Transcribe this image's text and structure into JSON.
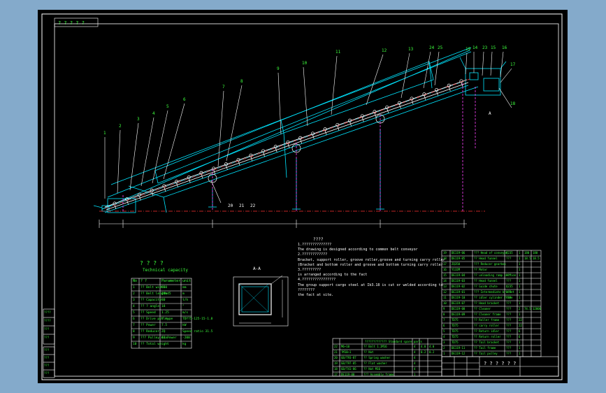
{
  "drawing": {
    "title_question_marks": "? ? ? ?",
    "title_subtitle": "Technical capacity",
    "corner_tag": "? ? ? ? ?",
    "section_label": "A-A",
    "view_arrow_label": "A",
    "balloons_top": [
      "1",
      "2",
      "3",
      "4",
      "5",
      "6",
      "7",
      "8",
      "9",
      "10",
      "11",
      "12",
      "13",
      "24",
      "25",
      "19",
      "14",
      "23",
      "15",
      "16",
      "17",
      "18"
    ],
    "balloons_bottom": [
      "20",
      "21",
      "22"
    ],
    "balloon_22_alt": "22"
  },
  "notes": {
    "heading": "????",
    "lines": [
      "1.??????????????",
      "  The drawing is designed according to common belt conveyor",
      "2.????????????",
      "  Bracket, support roller, groove roller,groove and turning carry roller",
      "  (Bracket and bottom roller and groove and bottom turning carry roller",
      "3.?????????",
      "  is arranged according to the fact",
      "4.????????????????",
      "  The group support cargo steel at Ib3.18 is cut or welded according to",
      "  ????????",
      "  the fact at site."
    ]
  },
  "tech_table": {
    "headers": [
      "No",
      "? ?",
      "Parameter",
      "unit"
    ],
    "rows": [
      [
        "1",
        "?? Belt width",
        "650",
        "mm"
      ],
      [
        "2",
        "?? Belt length",
        "10m45",
        "m"
      ],
      [
        "3",
        "?? Capacity",
        "80",
        "t/h"
      ],
      [
        "4",
        "?? ? angle",
        "18",
        "°"
      ],
      [
        "5",
        "?? Speed",
        "1.25",
        "m/s"
      ],
      [
        "6",
        "?? Drive pulley",
        "Y type",
        "TDY75-125-15-1.8"
      ],
      [
        "7",
        "?? Power",
        "7.5",
        "kW"
      ],
      [
        "8",
        "?? Reducer",
        "ZQ",
        "Speed ratio 31.5"
      ],
      [
        "9",
        "??? Pulley dia.",
        "63 Power",
        "-200"
      ],
      [
        "10",
        "?? Total weight",
        "",
        "kg"
      ]
    ]
  },
  "bom_right": {
    "rows": [
      [
        "19",
        "DE119-06",
        "??? Head of conveyor",
        "Q235",
        "1",
        "180",
        "180"
      ],
      [
        "18",
        "DE119-05",
        "?? Head funnel",
        "???",
        "1",
        "18.5",
        "18.5"
      ],
      [
        "17",
        "ZQ350",
        "??? Reducer gearbox",
        "",
        "1",
        "",
        ""
      ],
      [
        "16",
        "Y132M",
        "?? Motor",
        "",
        "1",
        "",
        ""
      ],
      [
        "15",
        "DE119-04",
        "?? unloading ramp section",
        "???",
        "1",
        "",
        ""
      ],
      [
        "14",
        "DE119-03",
        "?? Head funnel",
        "???",
        "1",
        "",
        ""
      ],
      [
        "13",
        "DE119-02",
        "?? Guide chute",
        "Q235",
        "1",
        "",
        ""
      ],
      [
        "12",
        "DE119-01",
        "??? Intermediate bracket",
        "???",
        "1",
        "",
        ""
      ],
      [
        "11",
        "DE119-10",
        "?? idler cylinder frame",
        "???",
        "1",
        "",
        ""
      ],
      [
        "10",
        "DE119-07",
        "?? Head bracket",
        "???",
        "1",
        "",
        ""
      ],
      [
        "9",
        "DE119-08",
        "?? Cleaner",
        "???",
        "2",
        "74.5",
        "12000"
      ],
      [
        "8",
        "DE119-09",
        "?? Cleaner frame",
        "???",
        "1",
        "",
        ""
      ],
      [
        "7",
        "TD75",
        "?? Roller frame",
        "???",
        "22",
        "",
        ""
      ],
      [
        "6",
        "TD75",
        "?? carry roller",
        "???",
        "22",
        "",
        ""
      ],
      [
        "5",
        "TD75",
        "?? Return idler",
        "???",
        "6",
        "",
        ""
      ],
      [
        "4",
        "TD75",
        "?? Return roller",
        "???",
        "6",
        "",
        ""
      ],
      [
        "3",
        "TD75",
        "?? Tail bracket",
        "???",
        "1",
        "",
        ""
      ],
      [
        "2",
        "DE119-11",
        "?? Tail frame",
        "???",
        "1",
        "",
        ""
      ],
      [
        "1",
        "DE119-12",
        "?? Tail pulley",
        "???",
        "1",
        "",
        ""
      ]
    ]
  },
  "bom_bottom": {
    "header": "????????????? Standard spare parts",
    "rows": [
      [
        "22",
        "M6~10",
        "?? Bolt 1.2M16",
        "",
        "4",
        "4.0",
        "4.0"
      ],
      [
        "21",
        "?M10~1",
        "?? Nut",
        "",
        "4",
        "0.2",
        "0.2"
      ],
      [
        "20",
        "GB/T93-87",
        "?? Spring washer",
        "",
        "4",
        "",
        ""
      ],
      [
        "19",
        "GB/T97-85",
        "?? Flat washer",
        "",
        "4",
        "",
        ""
      ],
      [
        "18",
        "GB/T41-86",
        "?? Nut M16",
        "",
        "4",
        "",
        ""
      ],
      [
        "17",
        "DE119-00",
        "??? Assembly frame",
        "",
        "1",
        "",
        ""
      ]
    ]
  },
  "title_block": {
    "text": "? ? ? ? ? ?"
  },
  "left_margin_labels": [
    "????",
    "????",
    "???",
    "???",
    "???",
    "???",
    "???",
    "???"
  ],
  "colors": {
    "background": "#000000",
    "frame": "#ffffff",
    "structure": "#00e5ff",
    "centerline": "#ff3030",
    "hidden": "#ff40ff",
    "text_green": "#3dff3d",
    "leader_white": "#ffffff"
  }
}
